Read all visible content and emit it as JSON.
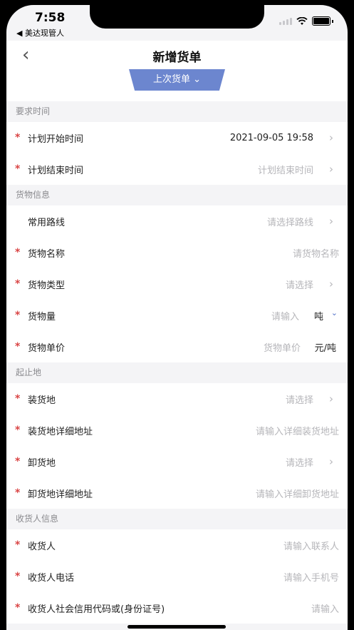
{
  "status_bar": {
    "time": "7:58",
    "back_app": "◀ 美达现管人"
  },
  "nav": {
    "title": "新增货单",
    "tab_label": "上次货单 ⌄"
  },
  "sections": {
    "time": "要求时间",
    "goods": "货物信息",
    "route": "起止地",
    "receiver": "收货人信息"
  },
  "rows": {
    "plan_start": {
      "label": "计划开始时间",
      "value": "2021-09-05 19:58"
    },
    "plan_end": {
      "label": "计划结束时间",
      "value": "计划结束时间"
    },
    "common_route": {
      "label": "常用路线",
      "value": "请选择路线"
    },
    "goods_name": {
      "label": "货物名称",
      "value": "请货物名称"
    },
    "goods_type": {
      "label": "货物类型",
      "value": "请选择"
    },
    "goods_qty": {
      "label": "货物量",
      "value": "请输入",
      "unit": "吨"
    },
    "goods_price": {
      "label": "货物单价",
      "value": "货物单价",
      "unit": "元/吨"
    },
    "load_place": {
      "label": "装货地",
      "value": "请选择"
    },
    "load_addr": {
      "label": "装货地详细地址",
      "value": "请输入详细装货地址"
    },
    "unload_place": {
      "label": "卸货地",
      "value": "请选择"
    },
    "unload_addr": {
      "label": "卸货地详细地址",
      "value": "请输入详细卸货地址"
    },
    "receiver": {
      "label": "收货人",
      "value": "请输入联系人"
    },
    "receiver_phone": {
      "label": "收货人电话",
      "value": "请输入手机号"
    },
    "receiver_credit": {
      "label": "收货人社会信用代码或(身份证号)",
      "value": "请输入"
    }
  },
  "icons": {
    "required": "*",
    "chevron_right": "›",
    "chevron_down": "⌄",
    "back": "‹"
  },
  "colors": {
    "accent": "#6c86cf",
    "required": "#d94444",
    "placeholder": "#b6b6ba"
  }
}
